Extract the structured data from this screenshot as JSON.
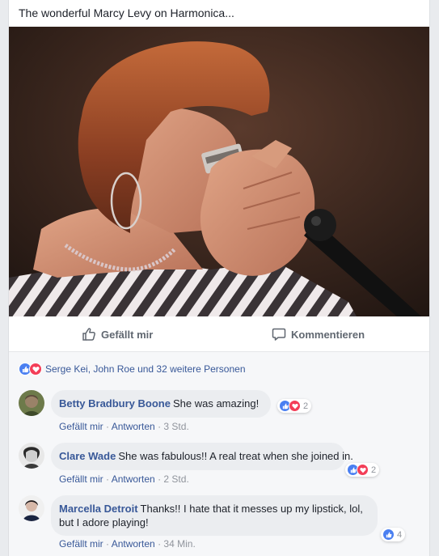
{
  "post": {
    "text": "The wonderful Marcy Levy on Harmonica...",
    "photo_icon": "performer-with-harmonica-photo"
  },
  "actions": {
    "like_label": "Gefällt mir",
    "comment_label": "Kommentieren"
  },
  "reactions": {
    "summary": "Serge Kei, John Roe und 32 weitere Personen",
    "icons": [
      "like-icon",
      "love-icon"
    ]
  },
  "comments": [
    {
      "author": "Betty Bradbury Boone",
      "text": "She was amazing!",
      "reaction_count": "2",
      "like": "Gefällt mir",
      "reply": "Antworten",
      "time": "3 Std."
    },
    {
      "author": "Clare Wade",
      "text": "She was fabulous!! A real treat when she joined in.",
      "reaction_count": "2",
      "like": "Gefällt mir",
      "reply": "Antworten",
      "time": "2 Std."
    },
    {
      "author": "Marcella Detroit",
      "text": "Thanks!! I hate that it messes up my lipstick, lol, but I adore playing!",
      "reaction_count": "4",
      "like": "Gefällt mir",
      "reply": "Antworten",
      "time": "34 Min."
    }
  ],
  "colors": {
    "link": "#385898",
    "like_blue": "#4a7ff1",
    "love_red": "#f33e58",
    "meta_gray": "#90949c"
  }
}
